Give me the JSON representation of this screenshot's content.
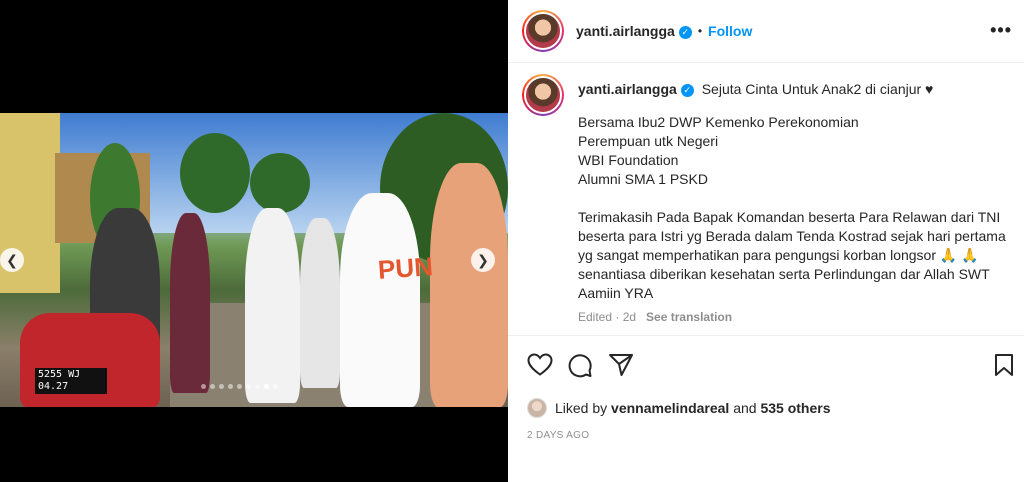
{
  "media": {
    "plate_text": "5255 WJ\n04.27",
    "shirt_text": "PUN",
    "carousel_dots": 9,
    "active_dot": 7
  },
  "header": {
    "username": "yanti.airlangga",
    "separator": "•",
    "follow_label": "Follow",
    "more_label": "•••"
  },
  "caption": {
    "username": "yanti.airlangga",
    "title": "Sejuta Cinta Untuk Anak2 di cianjur ♥",
    "lines": [
      "Bersama Ibu2 DWP Kemenko Perekonomian",
      "Perempuan utk Negeri",
      "WBI Foundation",
      "Alumni SMA 1 PSKD"
    ],
    "paragraph": "Terimakasih Pada Bapak Komandan beserta Para Relawan dari TNI beserta para Istri yg Berada dalam Tenda Kostrad sejak hari pertama yg sangat memperhatikan para pengungsi korban longsor 🙏 🙏  senantiasa diberikan kesehatan serta Perlindungan dar Allah SWT Aamiin YRA",
    "edited": "Edited · 2d",
    "see_translation": "See translation"
  },
  "likes": {
    "prefix": "Liked by",
    "user": "vennamelindareal",
    "middle": "and",
    "others": "535 others"
  },
  "date": "2 DAYS AGO",
  "colors": {
    "accent": "#0095f6",
    "text": "#262626",
    "muted": "#8e8e8e"
  }
}
